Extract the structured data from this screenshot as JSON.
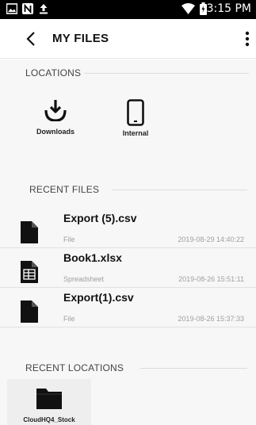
{
  "status_bar": {
    "time": "3:15 PM",
    "icons": [
      "image-icon",
      "n-notification-icon",
      "upload-icon",
      "wifi-icon",
      "battery-icon"
    ]
  },
  "app_bar": {
    "title": "MY FILES",
    "back_icon": "chevron-left-icon",
    "menu_icon": "more-vertical-icon"
  },
  "locations": {
    "header": "LOCATIONS",
    "items": [
      {
        "label": "Downloads",
        "icon": "download-icon"
      },
      {
        "label": "Internal",
        "icon": "phone-icon"
      }
    ]
  },
  "recent_files": {
    "header": "RECENT FILES",
    "items": [
      {
        "name": "Export (5).csv",
        "type": "File",
        "date": "2019-08-29 14:40:22",
        "icon": "file-icon"
      },
      {
        "name": "Book1.xlsx",
        "type": "Spreadsheet",
        "date": "2019-08-26 15:51:11",
        "icon": "spreadsheet-icon"
      },
      {
        "name": "Export(1).csv",
        "type": "File",
        "date": "2019-08-26 15:37:33",
        "icon": "file-icon"
      }
    ]
  },
  "recent_locations": {
    "header": "RECENT LOCATIONS",
    "items": [
      {
        "label": "CloudHQ4_Stock",
        "icon": "folder-icon"
      }
    ]
  }
}
